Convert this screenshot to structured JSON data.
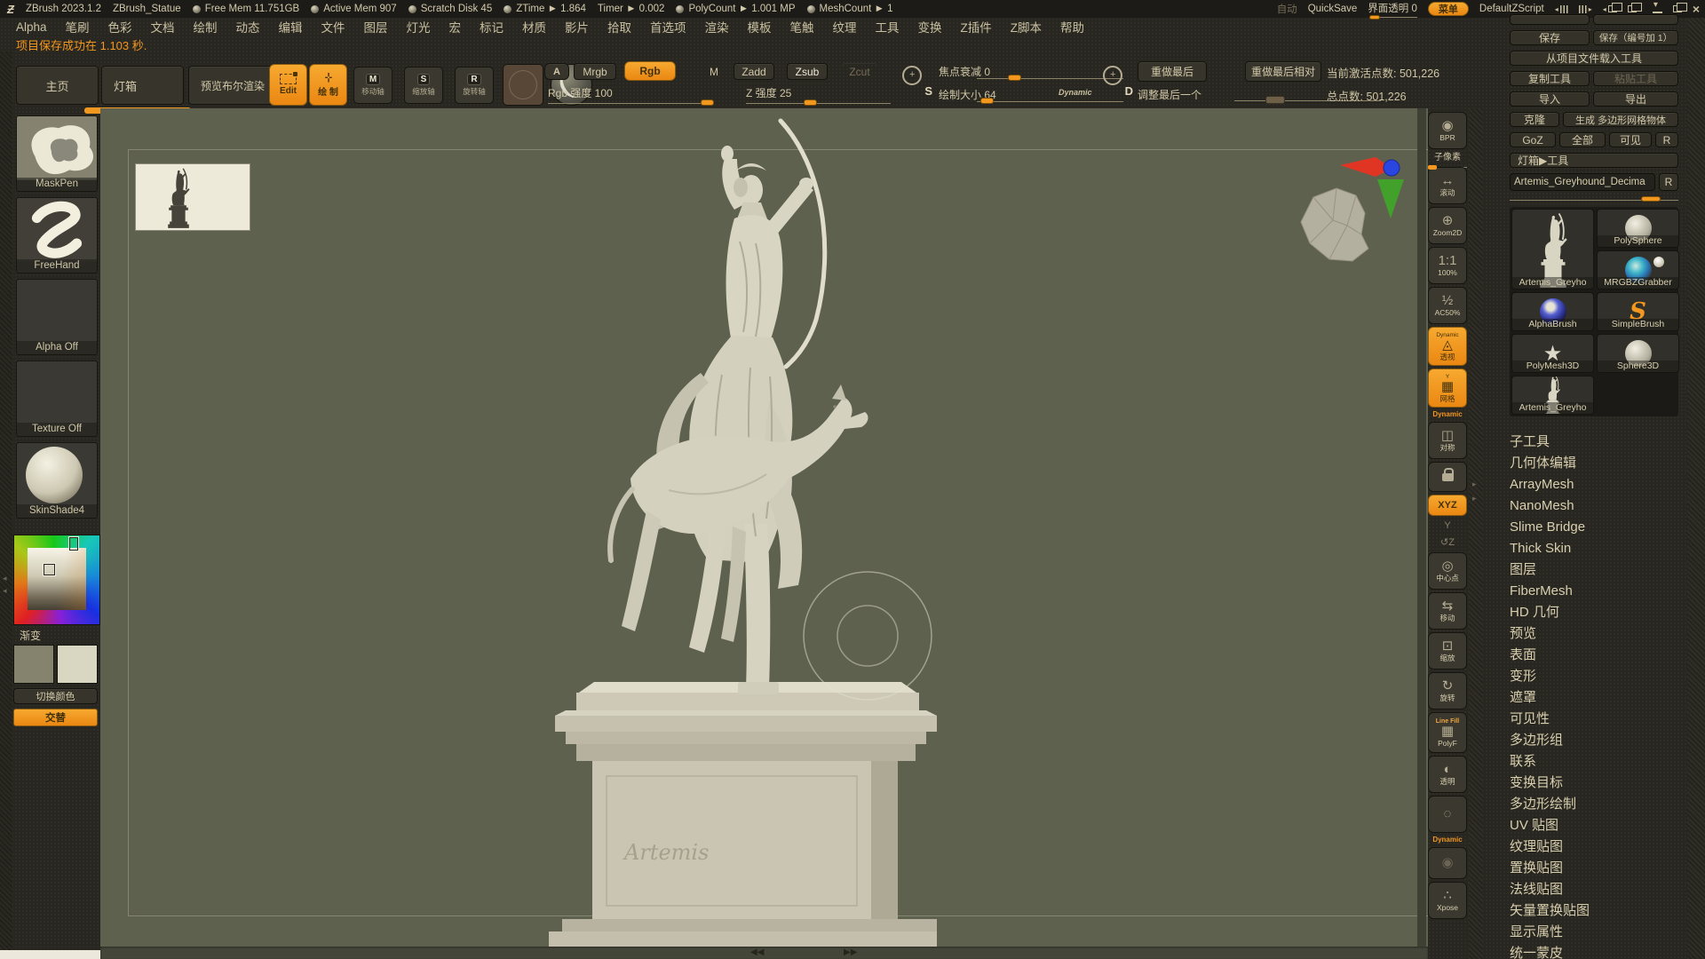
{
  "colors": {
    "accent": "#f2971f",
    "canvas": "#5f614f"
  },
  "titlebar": {
    "app_name": "ZBrush 2023.1.2",
    "document_name": "ZBrush_Statue",
    "stats": [
      {
        "label": "Free Mem 11.751GB",
        "kind": "dot"
      },
      {
        "label": "Active Mem 907",
        "kind": "dot"
      },
      {
        "label": "Scratch Disk 45",
        "kind": "dot"
      },
      {
        "label": "ZTime ► 1.864",
        "kind": "dot"
      },
      {
        "label": "Timer ► 0.002",
        "kind": "nodot"
      },
      {
        "label": "PolyCount ► 1.001 MP",
        "kind": "dot"
      },
      {
        "label": "MeshCount ► 1",
        "kind": "dot"
      }
    ],
    "auto_label": "自动",
    "quicksave_label": "QuickSave",
    "ui_opacity_label": "界面透明 0",
    "menu_button_label": "菜单",
    "zscript_name": "DefaultZScript"
  },
  "menubar": {
    "items": [
      {
        "label": "Alpha"
      },
      {
        "label": "笔刷"
      },
      {
        "label": "色彩"
      },
      {
        "label": "文档"
      },
      {
        "label": "绘制"
      },
      {
        "label": "动态"
      },
      {
        "label": "编辑"
      },
      {
        "label": "文件"
      },
      {
        "label": "图层"
      },
      {
        "label": "灯光"
      },
      {
        "label": "宏"
      },
      {
        "label": "标记"
      },
      {
        "label": "材质"
      },
      {
        "label": "影片"
      },
      {
        "label": "拾取"
      },
      {
        "label": "首选项"
      },
      {
        "label": "渲染"
      },
      {
        "label": "模板"
      },
      {
        "label": "笔触"
      },
      {
        "label": "纹理"
      },
      {
        "label": "工具"
      },
      {
        "label": "变换"
      },
      {
        "label": "Z插件"
      },
      {
        "label": "Z脚本"
      },
      {
        "label": "帮助"
      }
    ]
  },
  "status_message": "项目保存成功在 1.103 秒.",
  "shelf": {
    "home": "主页",
    "lightbox": "灯箱",
    "preview_boolean": "预览布尔渲染",
    "edit": "Edit",
    "draw": "绘 制",
    "move_gizmo": "移动轴",
    "scale_gizmo": "缩放轴",
    "rotate_gizmo": "旋转轴",
    "a_button": "A",
    "mrgb": "Mrgb",
    "rgb": "Rgb",
    "m_button": "M",
    "zadd": "Zadd",
    "zsub": "Zsub",
    "zcut": "Zcut",
    "rgb_intensity": "Rgb 强度 100",
    "z_intensity": "Z 强度 25",
    "s_letter": "S",
    "d_letter": "D",
    "focal_shift": "焦点衰减 0",
    "draw_size": "绘制大小 64",
    "dynamic": "Dynamic",
    "redo_last": "重做最后",
    "redo_last_relative": "重做最后相对",
    "adjust_last": "调整最后一个",
    "active_points": "当前激活点数: 501,226",
    "total_points": "总点数: 501,226"
  },
  "left_tray": {
    "maskpen": "MaskPen",
    "freehand": "FreeHand",
    "alpha_off": "Alpha Off",
    "texture_off": "Texture Off",
    "skinshade": "SkinShade4",
    "gradient_label": "渐变",
    "switch_colors_label": "切换颜色",
    "alternate_label": "交替"
  },
  "canvas": {
    "inscription": "Artemis"
  },
  "right_shelf": {
    "items": [
      {
        "label": "BPR",
        "glyph": "◉",
        "kind": "box"
      },
      {
        "label": "子像素",
        "kind": "textline"
      },
      {
        "label": "滚动",
        "glyph": "↔",
        "kind": "box"
      },
      {
        "label": "Zoom2D",
        "glyph": "⊕",
        "kind": "box"
      },
      {
        "label": "100%",
        "glyph": "1:1",
        "kind": "box"
      },
      {
        "label": "AC50%",
        "glyph": "½",
        "kind": "box"
      },
      {
        "label": "透视",
        "glyph": "◬",
        "top": "Dynamic",
        "kind": "orange"
      },
      {
        "label": "网格",
        "glyph": "▦",
        "top": "Y",
        "kind": "orange"
      },
      {
        "label": "Dynamic",
        "kind": "orangetext"
      },
      {
        "label": "对称",
        "glyph": "◫",
        "kind": "box"
      },
      {
        "label": "",
        "glyph": "",
        "kind": "lock"
      },
      {
        "label": "XYZ",
        "kind": "xyz"
      },
      {
        "label": "Y",
        "kind": "dimtext"
      },
      {
        "label": "↺Z",
        "kind": "dimtext"
      },
      {
        "label": "中心点",
        "glyph": "◎",
        "kind": "box"
      },
      {
        "label": "移动",
        "glyph": "⇆",
        "kind": "box"
      },
      {
        "label": "缩放",
        "glyph": "⊡",
        "kind": "box"
      },
      {
        "label": "旋转",
        "glyph": "↻",
        "kind": "box"
      },
      {
        "label": "PolyF",
        "glyph": "▦",
        "top": "Line Fill",
        "kind": "linefill"
      },
      {
        "label": "透明",
        "glyph": "◐",
        "kind": "box"
      },
      {
        "label": "",
        "glyph": "◌",
        "kind": "box"
      },
      {
        "label": "Dynamic",
        "kind": "orangetext"
      },
      {
        "label": "",
        "glyph": "◉",
        "kind": "boxdim"
      },
      {
        "label": "Xpose",
        "glyph": "∴",
        "kind": "box"
      }
    ]
  },
  "tool_palette": {
    "save": "保存",
    "save_numbered": "保存（编号加 1）",
    "load_from_project": "从项目文件载入工具",
    "copy_tool": "复制工具",
    "paste_tool": "粘贴工具",
    "import_label": "导入",
    "export_label": "导出",
    "clone_label": "克隆",
    "make_polymesh": "生成 多边形网格物体",
    "goz": "GoZ",
    "all_label": "全部",
    "visible_label": "可见",
    "r_label": "R",
    "lightbox_tool": "灯箱▶工具",
    "active_tool_name": "Artemis_Greyhound_Decima",
    "r2_label": "R",
    "thumbnails": [
      {
        "label": "Artemis_Greyho",
        "kind": "statue-big"
      },
      {
        "label": "PolySphere",
        "kind": "ball"
      },
      {
        "label": "MRGBZGrabber",
        "kind": "grabber"
      },
      {
        "label": "AlphaBrush",
        "kind": "alphaball"
      },
      {
        "label": "SimpleBrush",
        "kind": "sbrush"
      },
      {
        "label": "PolyMesh3D",
        "kind": "star"
      },
      {
        "label": "Sphere3D",
        "kind": "ball"
      },
      {
        "label": "Artemis_Greyho",
        "kind": "statue-small"
      }
    ],
    "sections": [
      {
        "label": "子工具"
      },
      {
        "label": "几何体编辑"
      },
      {
        "label": "ArrayMesh"
      },
      {
        "label": "NanoMesh"
      },
      {
        "label": "Slime Bridge"
      },
      {
        "label": "Thick Skin"
      },
      {
        "label": "图层"
      },
      {
        "label": "FiberMesh"
      },
      {
        "label": "HD 几何"
      },
      {
        "label": "预览"
      },
      {
        "label": "表面"
      },
      {
        "label": "变形"
      },
      {
        "label": "遮罩"
      },
      {
        "label": "可见性"
      },
      {
        "label": "多边形组"
      },
      {
        "label": "联系"
      },
      {
        "label": "变换目标"
      },
      {
        "label": "多边形绘制"
      },
      {
        "label": "UV 贴图"
      },
      {
        "label": "纹理贴图"
      },
      {
        "label": "置换贴图"
      },
      {
        "label": "法线贴图"
      },
      {
        "label": "矢量置换贴图"
      },
      {
        "label": "显示属性"
      },
      {
        "label": "统一蒙皮"
      }
    ]
  },
  "bottom_scrollbar": {
    "left_arrows": "◀◀",
    "right_arrows": "▶▶"
  }
}
